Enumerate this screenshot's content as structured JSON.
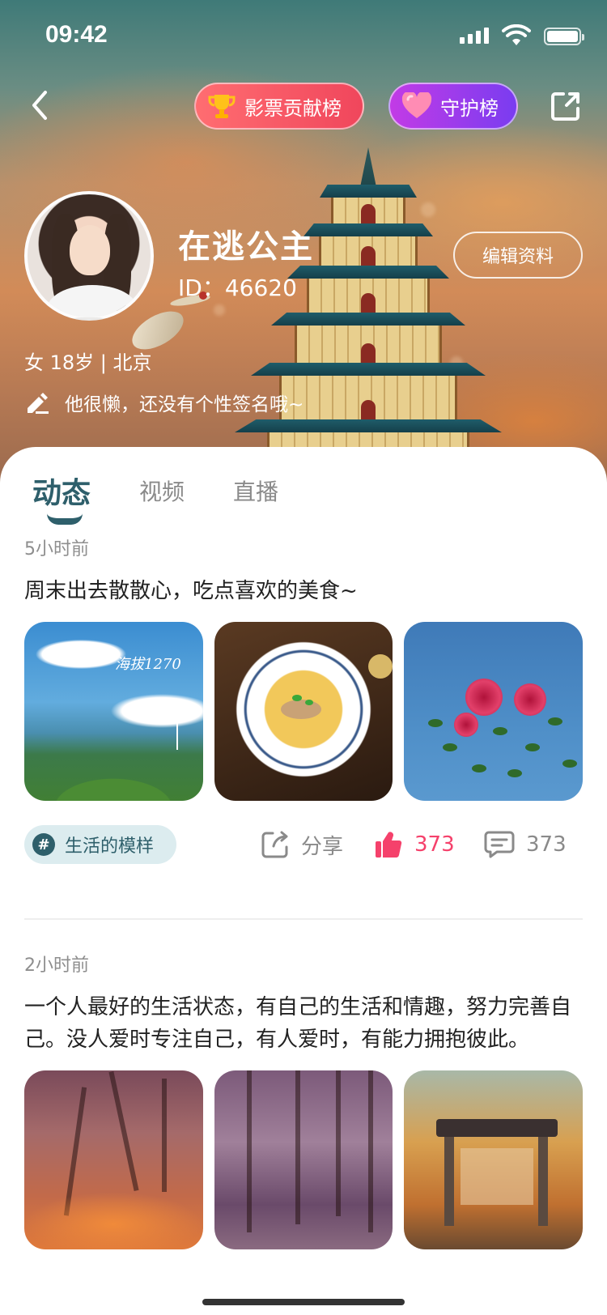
{
  "status_bar": {
    "time": "09:42"
  },
  "nav": {
    "contrib_label": "影票贡献榜",
    "guard_label": "守护榜"
  },
  "profile": {
    "name": "在逃公主",
    "id_text": "ID：46620",
    "edit_label": "编辑资料",
    "meta": "女 18岁 | 北京",
    "bio": "他很懒，还没有个性签名哦~"
  },
  "tabs": [
    {
      "label": "动态",
      "active": true
    },
    {
      "label": "视频",
      "active": false
    },
    {
      "label": "直播",
      "active": false
    }
  ],
  "posts": [
    {
      "time": "5小时前",
      "text": "周末出去散散心，吃点喜欢的美食~",
      "photos": [
        "mountain-landscape",
        "noodle-soup",
        "roses-sky"
      ],
      "photo_caption": "海拔1270",
      "topic": "生活的模样",
      "share_label": "分享",
      "likes": "373",
      "comments": "373"
    },
    {
      "time": "2小时前",
      "text": "一个人最好的生活状态，有自己的生活和情趣，努力完善自己。没人爱时专注自己，有人爱时，有能力拥抱彼此。",
      "photos": [
        "autumn-forest",
        "purple-forest",
        "gate-sunset"
      ]
    }
  ],
  "colors": {
    "accent": "#2e5f6b",
    "like": "#f5416b",
    "topic_bg": "#dcecef",
    "contrib_pill": "#f0465c",
    "guard_pill": "#8a3cef"
  },
  "icons": [
    "back-icon",
    "trophy-icon",
    "heart-icon",
    "share-out-icon",
    "edit-pen-icon",
    "hashtag-icon",
    "share-icon",
    "thumb-up-icon",
    "comment-icon"
  ]
}
